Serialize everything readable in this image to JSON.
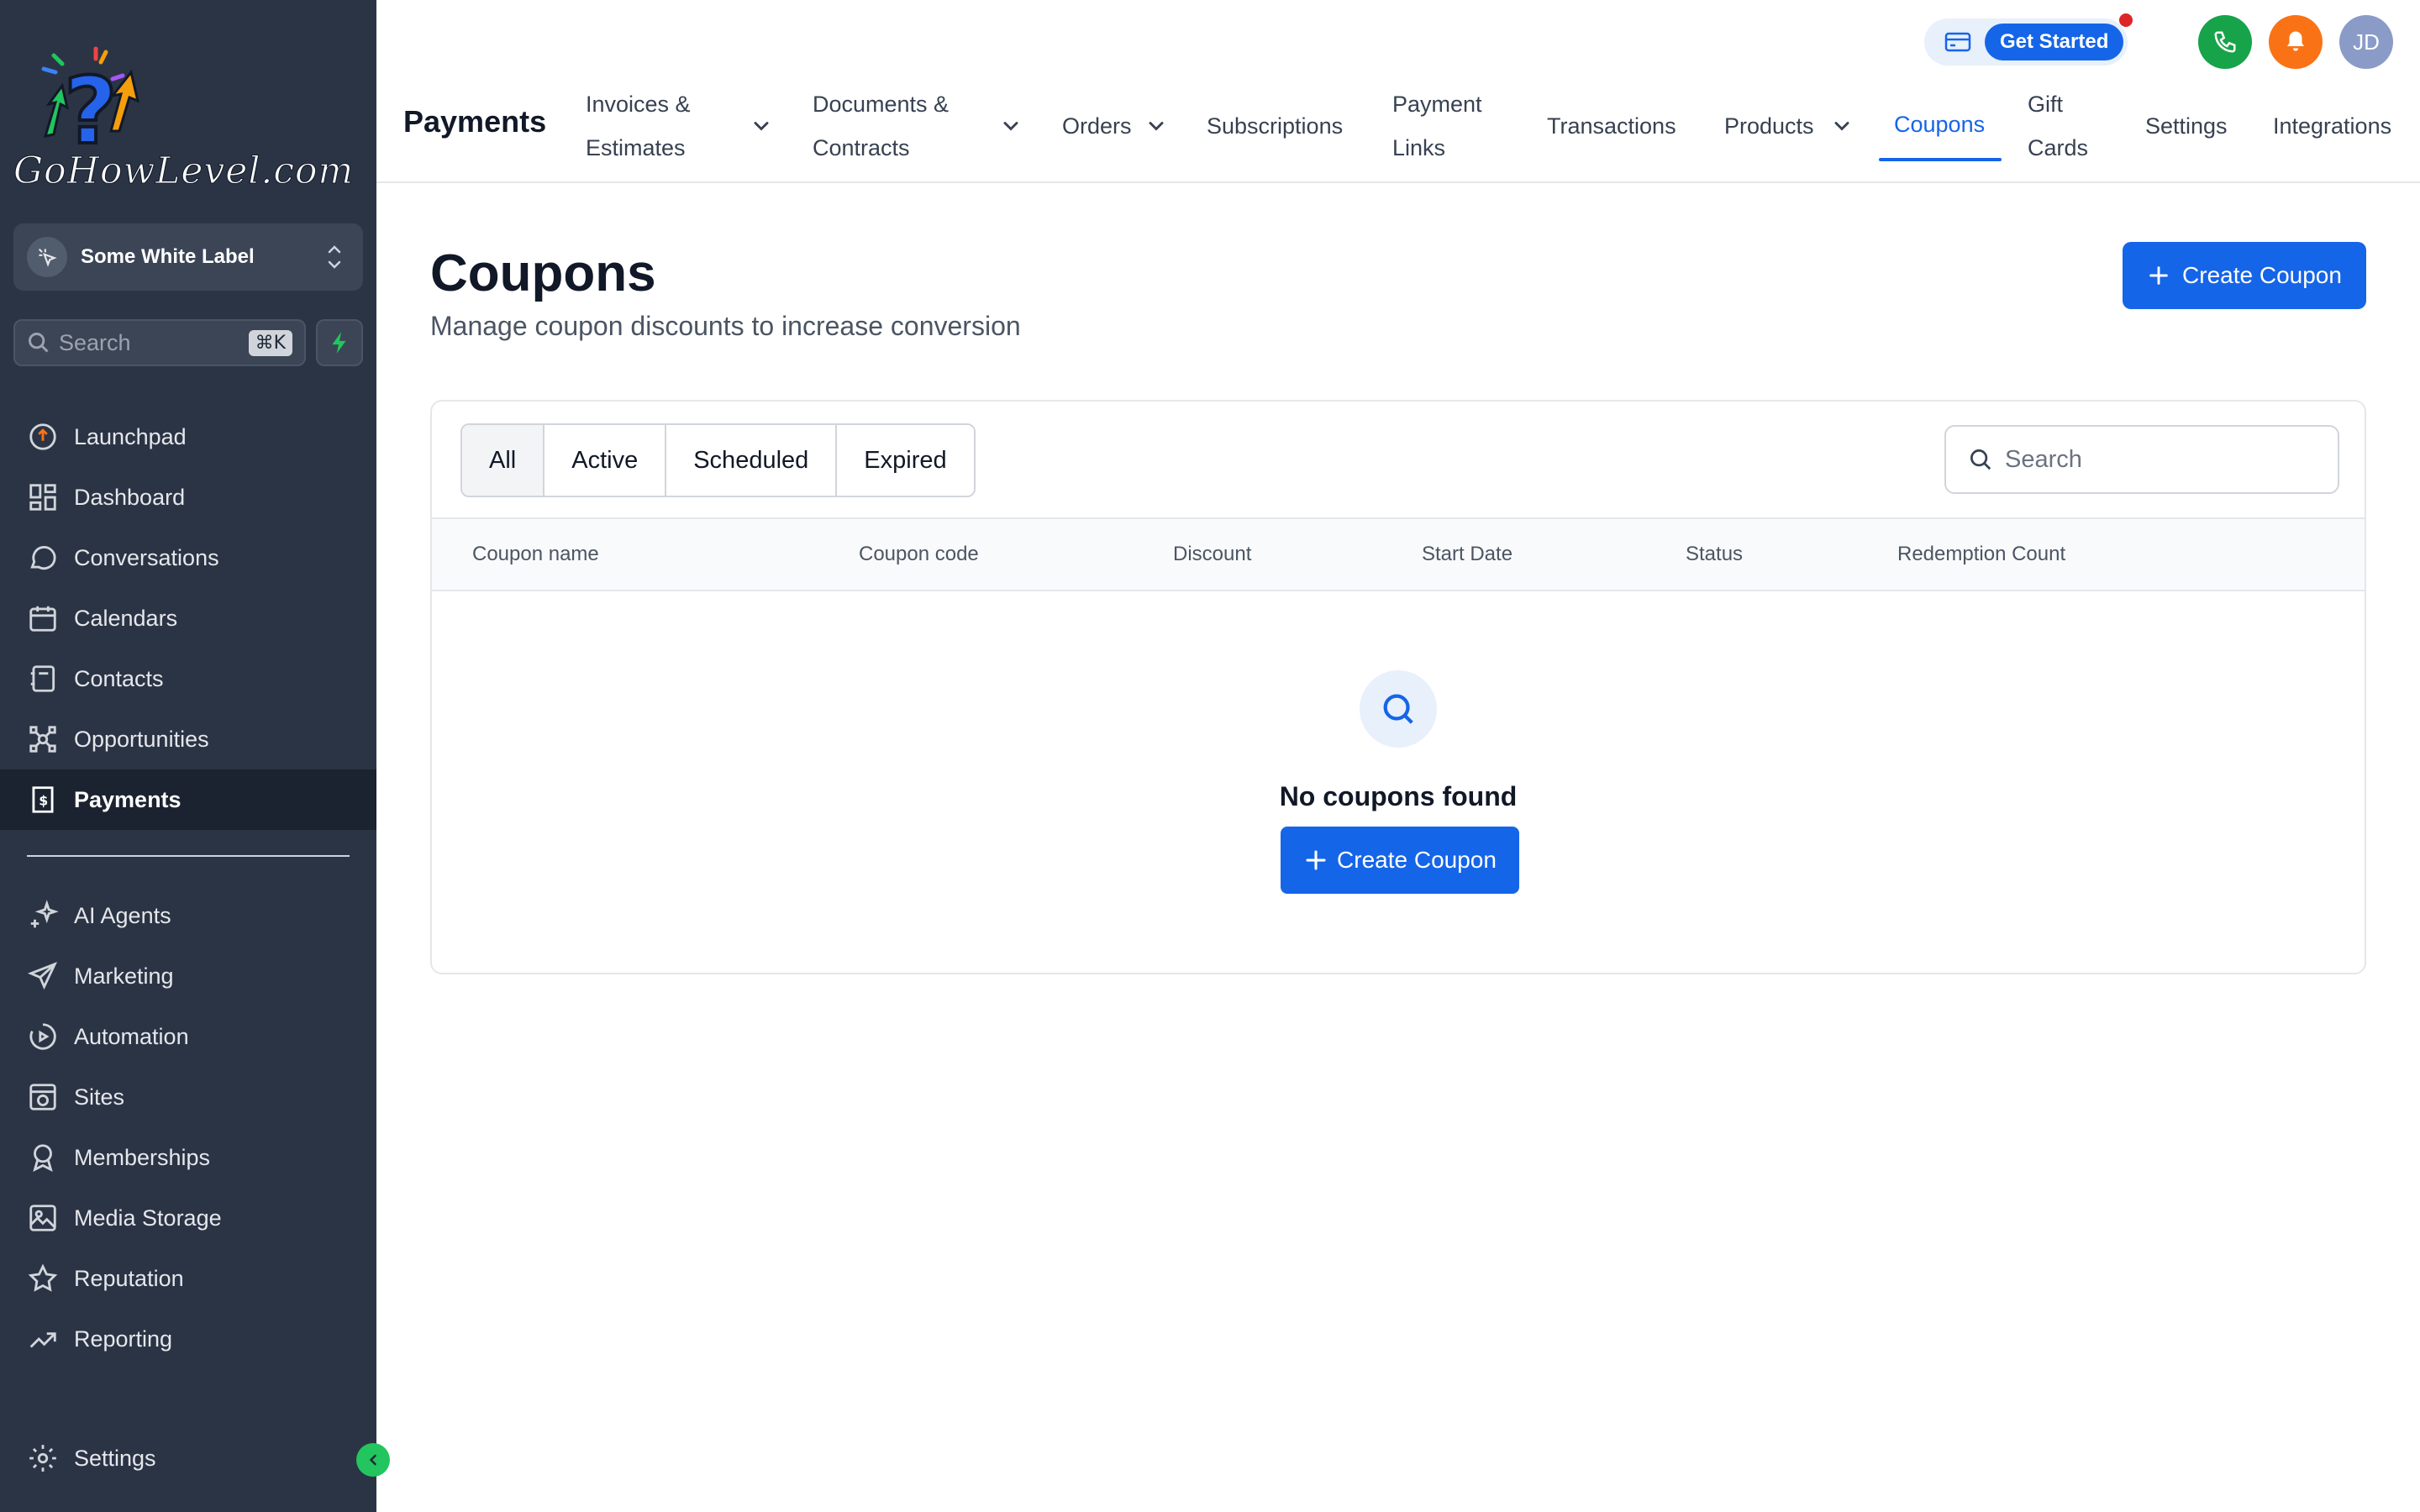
{
  "brand": {
    "logo_text": "GoHowLevel.com",
    "colors": {
      "sidebar": "#2b3445",
      "accent": "#1565e8",
      "phone": "#16a34a",
      "bell": "#f97316",
      "avatar": "#8b9bc8"
    }
  },
  "sidebar": {
    "account_switcher": {
      "label": "Some White Label",
      "icon": "cursor-click-icon"
    },
    "search": {
      "placeholder": "Search",
      "shortcut": "⌘K"
    },
    "quick_action_icon": "bolt-icon",
    "items": [
      {
        "label": "Launchpad",
        "icon": "launchpad-icon"
      },
      {
        "label": "Dashboard",
        "icon": "dashboard-grid-icon"
      },
      {
        "label": "Conversations",
        "icon": "chat-bubble-icon"
      },
      {
        "label": "Calendars",
        "icon": "calendar-icon"
      },
      {
        "label": "Contacts",
        "icon": "contacts-book-icon"
      },
      {
        "label": "Opportunities",
        "icon": "opportunities-icon"
      },
      {
        "label": "Payments",
        "icon": "payments-receipt-icon",
        "active": true
      }
    ],
    "secondary_items": [
      {
        "label": "AI Agents",
        "icon": "sparkles-icon"
      },
      {
        "label": "Marketing",
        "icon": "paper-plane-icon"
      },
      {
        "label": "Automation",
        "icon": "automation-icon"
      },
      {
        "label": "Sites",
        "icon": "sites-globe-icon"
      },
      {
        "label": "Memberships",
        "icon": "badge-icon"
      },
      {
        "label": "Media Storage",
        "icon": "image-icon"
      },
      {
        "label": "Reputation",
        "icon": "star-icon"
      },
      {
        "label": "Reporting",
        "icon": "trend-line-icon"
      }
    ],
    "settings": {
      "label": "Settings",
      "icon": "gear-icon"
    },
    "collapse_icon": "chevron-left-icon"
  },
  "topbar": {
    "get_started": "Get Started",
    "avatar_initials": "JD",
    "section_title": "Payments",
    "tabs": [
      {
        "line1": "Invoices &",
        "line2": "Estimates",
        "dropdown": true
      },
      {
        "line1": "Documents &",
        "line2": "Contracts",
        "dropdown": true
      },
      {
        "label": "Orders",
        "dropdown": true
      },
      {
        "label": "Subscriptions"
      },
      {
        "line1": "Payment",
        "line2": "Links"
      },
      {
        "label": "Transactions"
      },
      {
        "label": "Products",
        "dropdown": true
      },
      {
        "label": "Coupons",
        "active": true
      },
      {
        "line1": "Gift",
        "line2": "Cards"
      },
      {
        "label": "Settings"
      },
      {
        "label": "Integrations"
      }
    ]
  },
  "main": {
    "title": "Coupons",
    "subtitle": "Manage coupon discounts to increase conversion",
    "create_button": "Create Coupon",
    "filters": [
      "All",
      "Active",
      "Scheduled",
      "Expired"
    ],
    "selected_filter": "All",
    "search_placeholder": "Search",
    "columns": [
      "Coupon name",
      "Coupon code",
      "Discount",
      "Start Date",
      "Status",
      "Redemption Count"
    ],
    "empty_state": {
      "message": "No coupons found",
      "button": "Create Coupon",
      "icon": "search-icon"
    }
  }
}
